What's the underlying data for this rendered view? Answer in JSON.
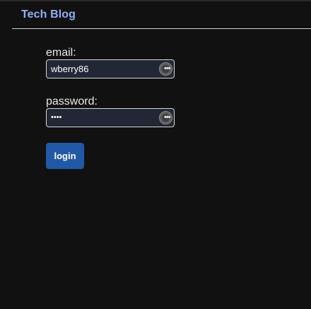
{
  "header": {
    "brand": "Tech Blog"
  },
  "login_form": {
    "email_label": "email:",
    "email_value": "wberry86",
    "password_label": "password:",
    "password_masked": "••••",
    "login_label": "login"
  },
  "colors": {
    "background": "#111111",
    "brand": "#8fb0f5",
    "button": "#2159a6",
    "input_background": "#222736"
  },
  "icons": {
    "autofill": "autofill-key-icon"
  }
}
